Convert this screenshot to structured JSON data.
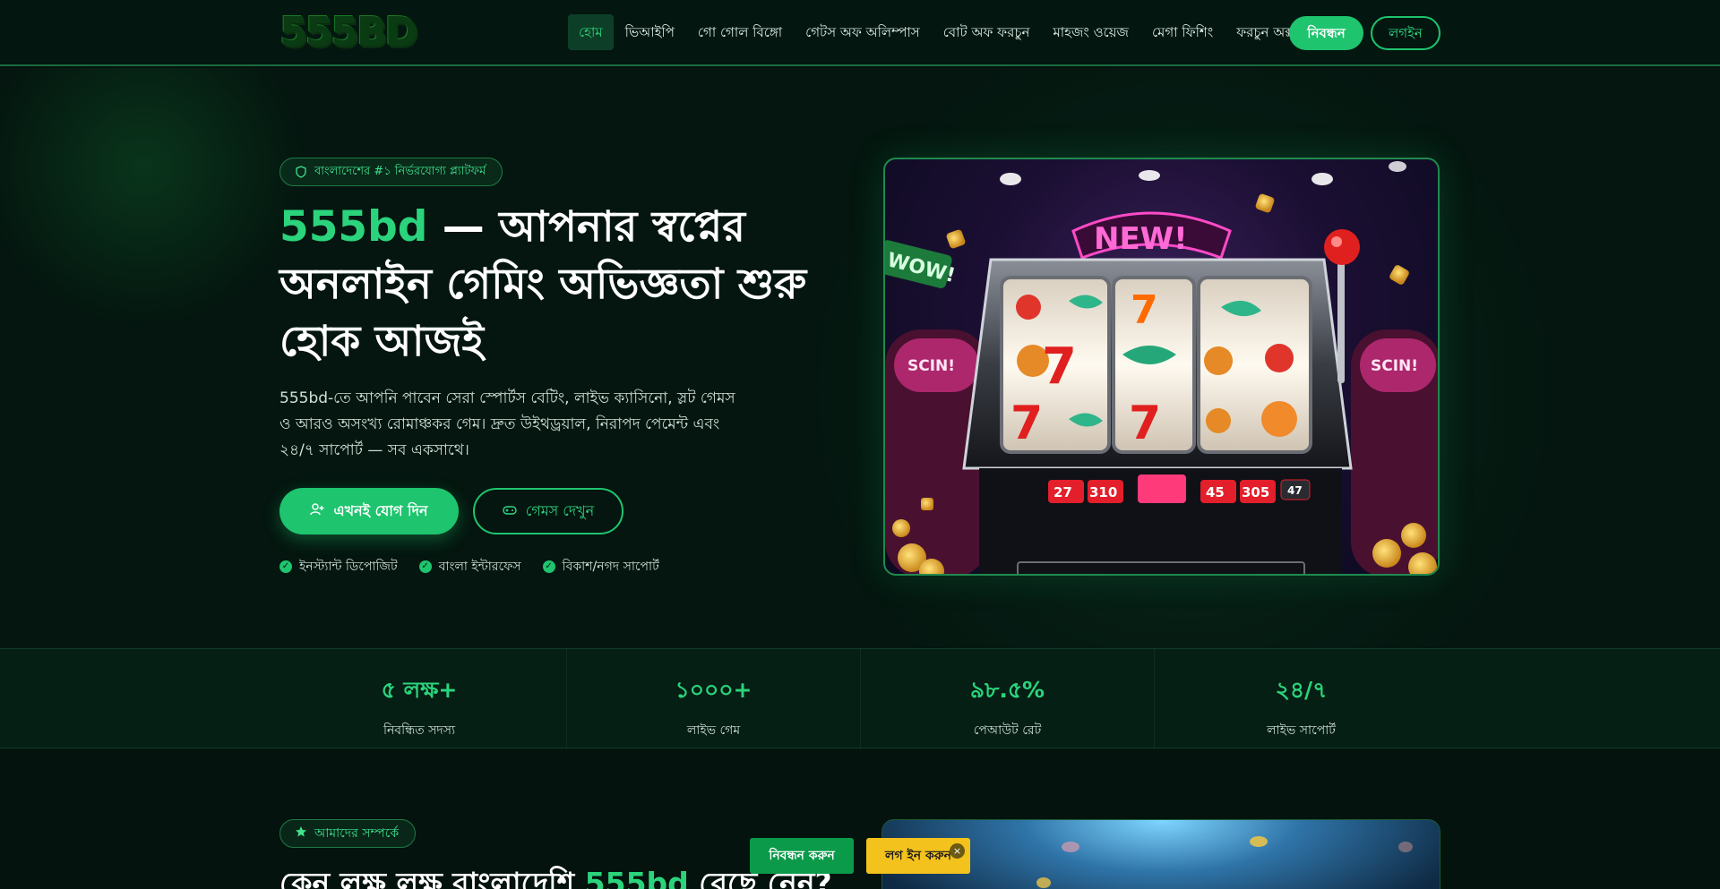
{
  "header": {
    "logo": "555BD",
    "nav": [
      "হোম",
      "ভিআইপি",
      "গো গোল বিঙ্গো",
      "গেটস অফ অলিম্পাস",
      "বোট অফ ফরচুন",
      "মাহজং ওয়েজ",
      "মেগা ফিশিং",
      "ফরচুন অক্স"
    ],
    "register_label": "নিবন্ধন",
    "login_label": "লগইন"
  },
  "hero": {
    "badge": "বাংলাদেশের #১ নির্ভরযোগ্য প্ল্যাটফর্ম",
    "title_accent": "555bd",
    "title_rest": " — আপনার স্বপ্নের অনলাইন গেমিং অভিজ্ঞতা শুরু হোক আজই",
    "description": "555bd-তে আপনি পাবেন সেরা স্পোর্টস বেটিং, লাইভ ক্যাসিনো, স্লট গেমস ও আরও অসংখ্য রোমাঞ্চকর গেম। দ্রুত উইথড্রয়াল, নিরাপদ পেমেন্ট এবং ২৪/৭ সাপোর্ট — সব একসাথে।",
    "cta_join": "এখনই যোগ দিন",
    "cta_games": "গেমস দেখুন",
    "features": [
      "ইনস্ট্যান্ট ডিপোজিট",
      "বাংলা ইন্টারফেস",
      "বিকাশ/নগদ সাপোর্ট"
    ],
    "image_signs": {
      "new": "NEW!",
      "wow": "WOW!",
      "scin": "SCIN!"
    },
    "reel_numbers": [
      "27",
      "310",
      "45",
      "305",
      "47"
    ]
  },
  "stats": [
    {
      "value": "৫ লক্ষ+",
      "label": "নিবন্ধিত সদস্য"
    },
    {
      "value": "১০০০+",
      "label": "লাইভ গেম"
    },
    {
      "value": "৯৮.৫%",
      "label": "পেআউট রেট"
    },
    {
      "value": "২৪/৭",
      "label": "লাইভ সাপোর্ট"
    }
  ],
  "about": {
    "badge": "আমাদের সম্পর্কে",
    "title_start": "কেন লক্ষ লক্ষ বাংলাদেশি ",
    "title_accent": "555bd",
    "title_end": " বেছে নেন?"
  },
  "floating": {
    "register": "নিবন্ধন করুন",
    "login": "লগ ইন করুন",
    "close": "×"
  },
  "colors": {
    "accent": "#1ec46e",
    "bg": "#04140e",
    "gold": "#f3c21c"
  }
}
